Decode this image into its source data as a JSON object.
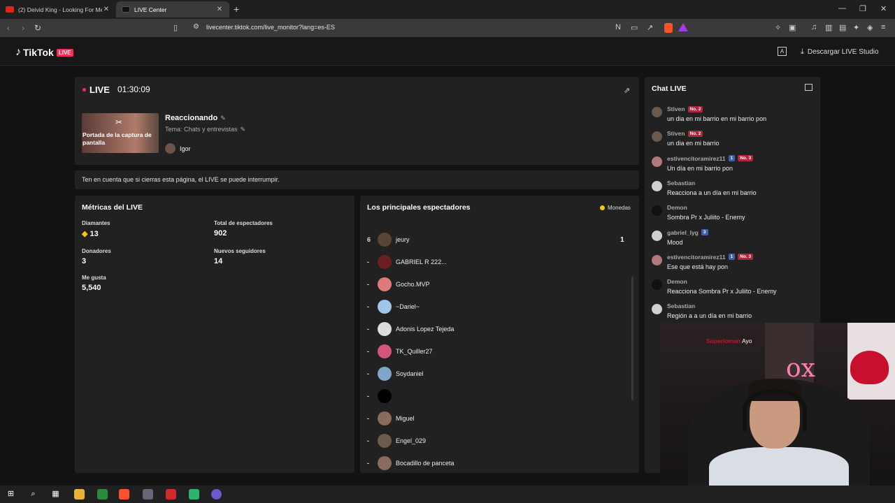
{
  "browser": {
    "tabs": [
      {
        "label": "(2) Deivid King - Looking For Me",
        "active": false
      },
      {
        "label": "LIVE Center",
        "active": true
      }
    ],
    "url": "livecenter.tiktok.com/live_monitor?lang=es-ES"
  },
  "header": {
    "brand": "TikTok",
    "live_badge": "LIVE",
    "download_label": "Descargar LIVE Studio"
  },
  "live": {
    "status": "LIVE",
    "elapsed": "01:30:09",
    "cover_caption": "Portada de la captura de pantalla",
    "title": "Reaccionando",
    "topic": "Tema: Chats y entrevistas",
    "host": "Igor"
  },
  "notice": "Ten en cuenta que si cierras esta página, el LIVE se puede interrumpir.",
  "metrics": {
    "title": "Métricas del LIVE",
    "items": [
      {
        "label": "Diamantes",
        "value": "13"
      },
      {
        "label": "Total de espectadores",
        "value": "902"
      },
      {
        "label": "Donadores",
        "value": "3"
      },
      {
        "label": "Nuevos seguidores",
        "value": "14"
      },
      {
        "label": "Me gusta",
        "value": "5,540"
      }
    ]
  },
  "viewers": {
    "title": "Los principales espectadores",
    "currency_label": "Monedas",
    "rows": [
      {
        "rank": "6",
        "name": "jeury",
        "coins": "1",
        "color": "#5a4434"
      },
      {
        "rank": "-",
        "name": "GABRIEL R 222...",
        "coins": "",
        "color": "#6b1f1f"
      },
      {
        "rank": "-",
        "name": "Gocho.MVP",
        "coins": "",
        "color": "#e07a7a"
      },
      {
        "rank": "-",
        "name": "~Dariel~",
        "coins": "",
        "color": "#9fc6e8"
      },
      {
        "rank": "-",
        "name": "Adonis Lopez Tejeda",
        "coins": "",
        "color": "#dcdcdc"
      },
      {
        "rank": "-",
        "name": "TK_Quiller27",
        "coins": "",
        "color": "#d2557b"
      },
      {
        "rank": "-",
        "name": "Soydaniel",
        "coins": "",
        "color": "#7fa6c9"
      },
      {
        "rank": "-",
        "name": "",
        "coins": "",
        "color": "#000000"
      },
      {
        "rank": "-",
        "name": "Miguel",
        "coins": "",
        "color": "#8a6a58"
      },
      {
        "rank": "-",
        "name": "Engel_029",
        "coins": "",
        "color": "#6c5a4d"
      },
      {
        "rank": "-",
        "name": "Bocadillo de panceta",
        "coins": "",
        "color": "#8b6b5b"
      }
    ]
  },
  "chat": {
    "title": "Chat LIVE",
    "messages": [
      {
        "user": "Stiven",
        "badges": [
          {
            "text": "No. 2",
            "kind": "red"
          }
        ],
        "text": "un dia en mi barrio en mi barrio pon",
        "color": "#6b5a4a"
      },
      {
        "user": "Stiven",
        "badges": [
          {
            "text": "No. 2",
            "kind": "red"
          }
        ],
        "text": "un dia en mi barrio",
        "color": "#6b5a4a"
      },
      {
        "user": "estivencitoramirez11",
        "badges": [
          {
            "text": "1",
            "kind": "blue"
          },
          {
            "text": "No. 3",
            "kind": "red"
          }
        ],
        "text": "Un día en mi barrio pon",
        "color": "#b07a7a"
      },
      {
        "user": "Sebastian",
        "badges": [],
        "text": "Reacciona a un día en mi barrio",
        "color": "#d0d0d0"
      },
      {
        "user": "Demon",
        "badges": [],
        "text": "Sombra Pr x Juliito - Enemy",
        "color": "#111111"
      },
      {
        "user": "gabriel_lyg",
        "badges": [
          {
            "text": "3",
            "kind": "blue"
          }
        ],
        "text": "Mood",
        "color": "#d0d0d0"
      },
      {
        "user": "estivencitoramirez11",
        "badges": [
          {
            "text": "1",
            "kind": "blue"
          },
          {
            "text": "No. 3",
            "kind": "red"
          }
        ],
        "text": "Ese que está hay pon",
        "color": "#b07a7a"
      },
      {
        "user": "Demon",
        "badges": [],
        "text": "Reacciona Sombra Pr x Juliito - Enemy",
        "color": "#111111"
      },
      {
        "user": "Sebastian",
        "badges": [],
        "text": "Región a a un día en mi barrio",
        "color": "#d0d0d0"
      }
    ]
  },
  "overlay": {
    "chat_user": "Superloman",
    "chat_text": "Ayo"
  }
}
